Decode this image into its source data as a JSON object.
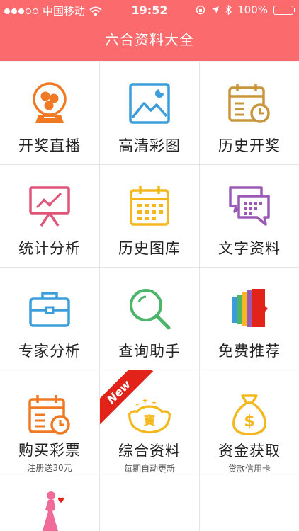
{
  "status_bar": {
    "carrier": "中国移动",
    "time": "19:52",
    "battery": "100%",
    "icons": [
      "signal-dots-icon",
      "wifi-icon",
      "lock-rotation-icon",
      "location-arrow-icon",
      "bluetooth-icon",
      "battery-icon"
    ]
  },
  "header": {
    "title": "六合资料大全"
  },
  "grid": {
    "items": [
      {
        "label": "开奖直播",
        "icon": "lottery-ball-icon"
      },
      {
        "label": "高清彩图",
        "icon": "picture-icon"
      },
      {
        "label": "历史开奖",
        "icon": "calendar-clock-icon"
      },
      {
        "label": "统计分析",
        "icon": "chart-board-icon"
      },
      {
        "label": "历史图库",
        "icon": "calendar-grid-icon"
      },
      {
        "label": "文字资料",
        "icon": "chat-text-icon"
      },
      {
        "label": "专家分析",
        "icon": "briefcase-icon"
      },
      {
        "label": "查询助手",
        "icon": "magnifier-icon"
      },
      {
        "label": "免费推荐",
        "icon": "colored-book-icon"
      },
      {
        "label": "购买彩票",
        "sublabel": "注册送30元",
        "icon": "calendar-clock-icon"
      },
      {
        "label": "综合资料",
        "sublabel": "每期自动更新",
        "icon": "gold-ingot-icon",
        "badge": "New"
      },
      {
        "label": "资金获取",
        "sublabel": "贷款信用卡",
        "icon": "money-bag-icon"
      },
      {
        "label": "",
        "icon": "woman-silhouette-icon"
      },
      {
        "label": ""
      },
      {
        "label": ""
      }
    ]
  },
  "colors": {
    "header": "#fb6b6e",
    "orange": "#f07a24",
    "blue": "#3c9ddc",
    "brown": "#c8963c",
    "pink": "#e0547a",
    "yellow": "#f4b81e",
    "purple": "#9b59b6",
    "green": "#4cb56a",
    "red": "#e2231a"
  }
}
